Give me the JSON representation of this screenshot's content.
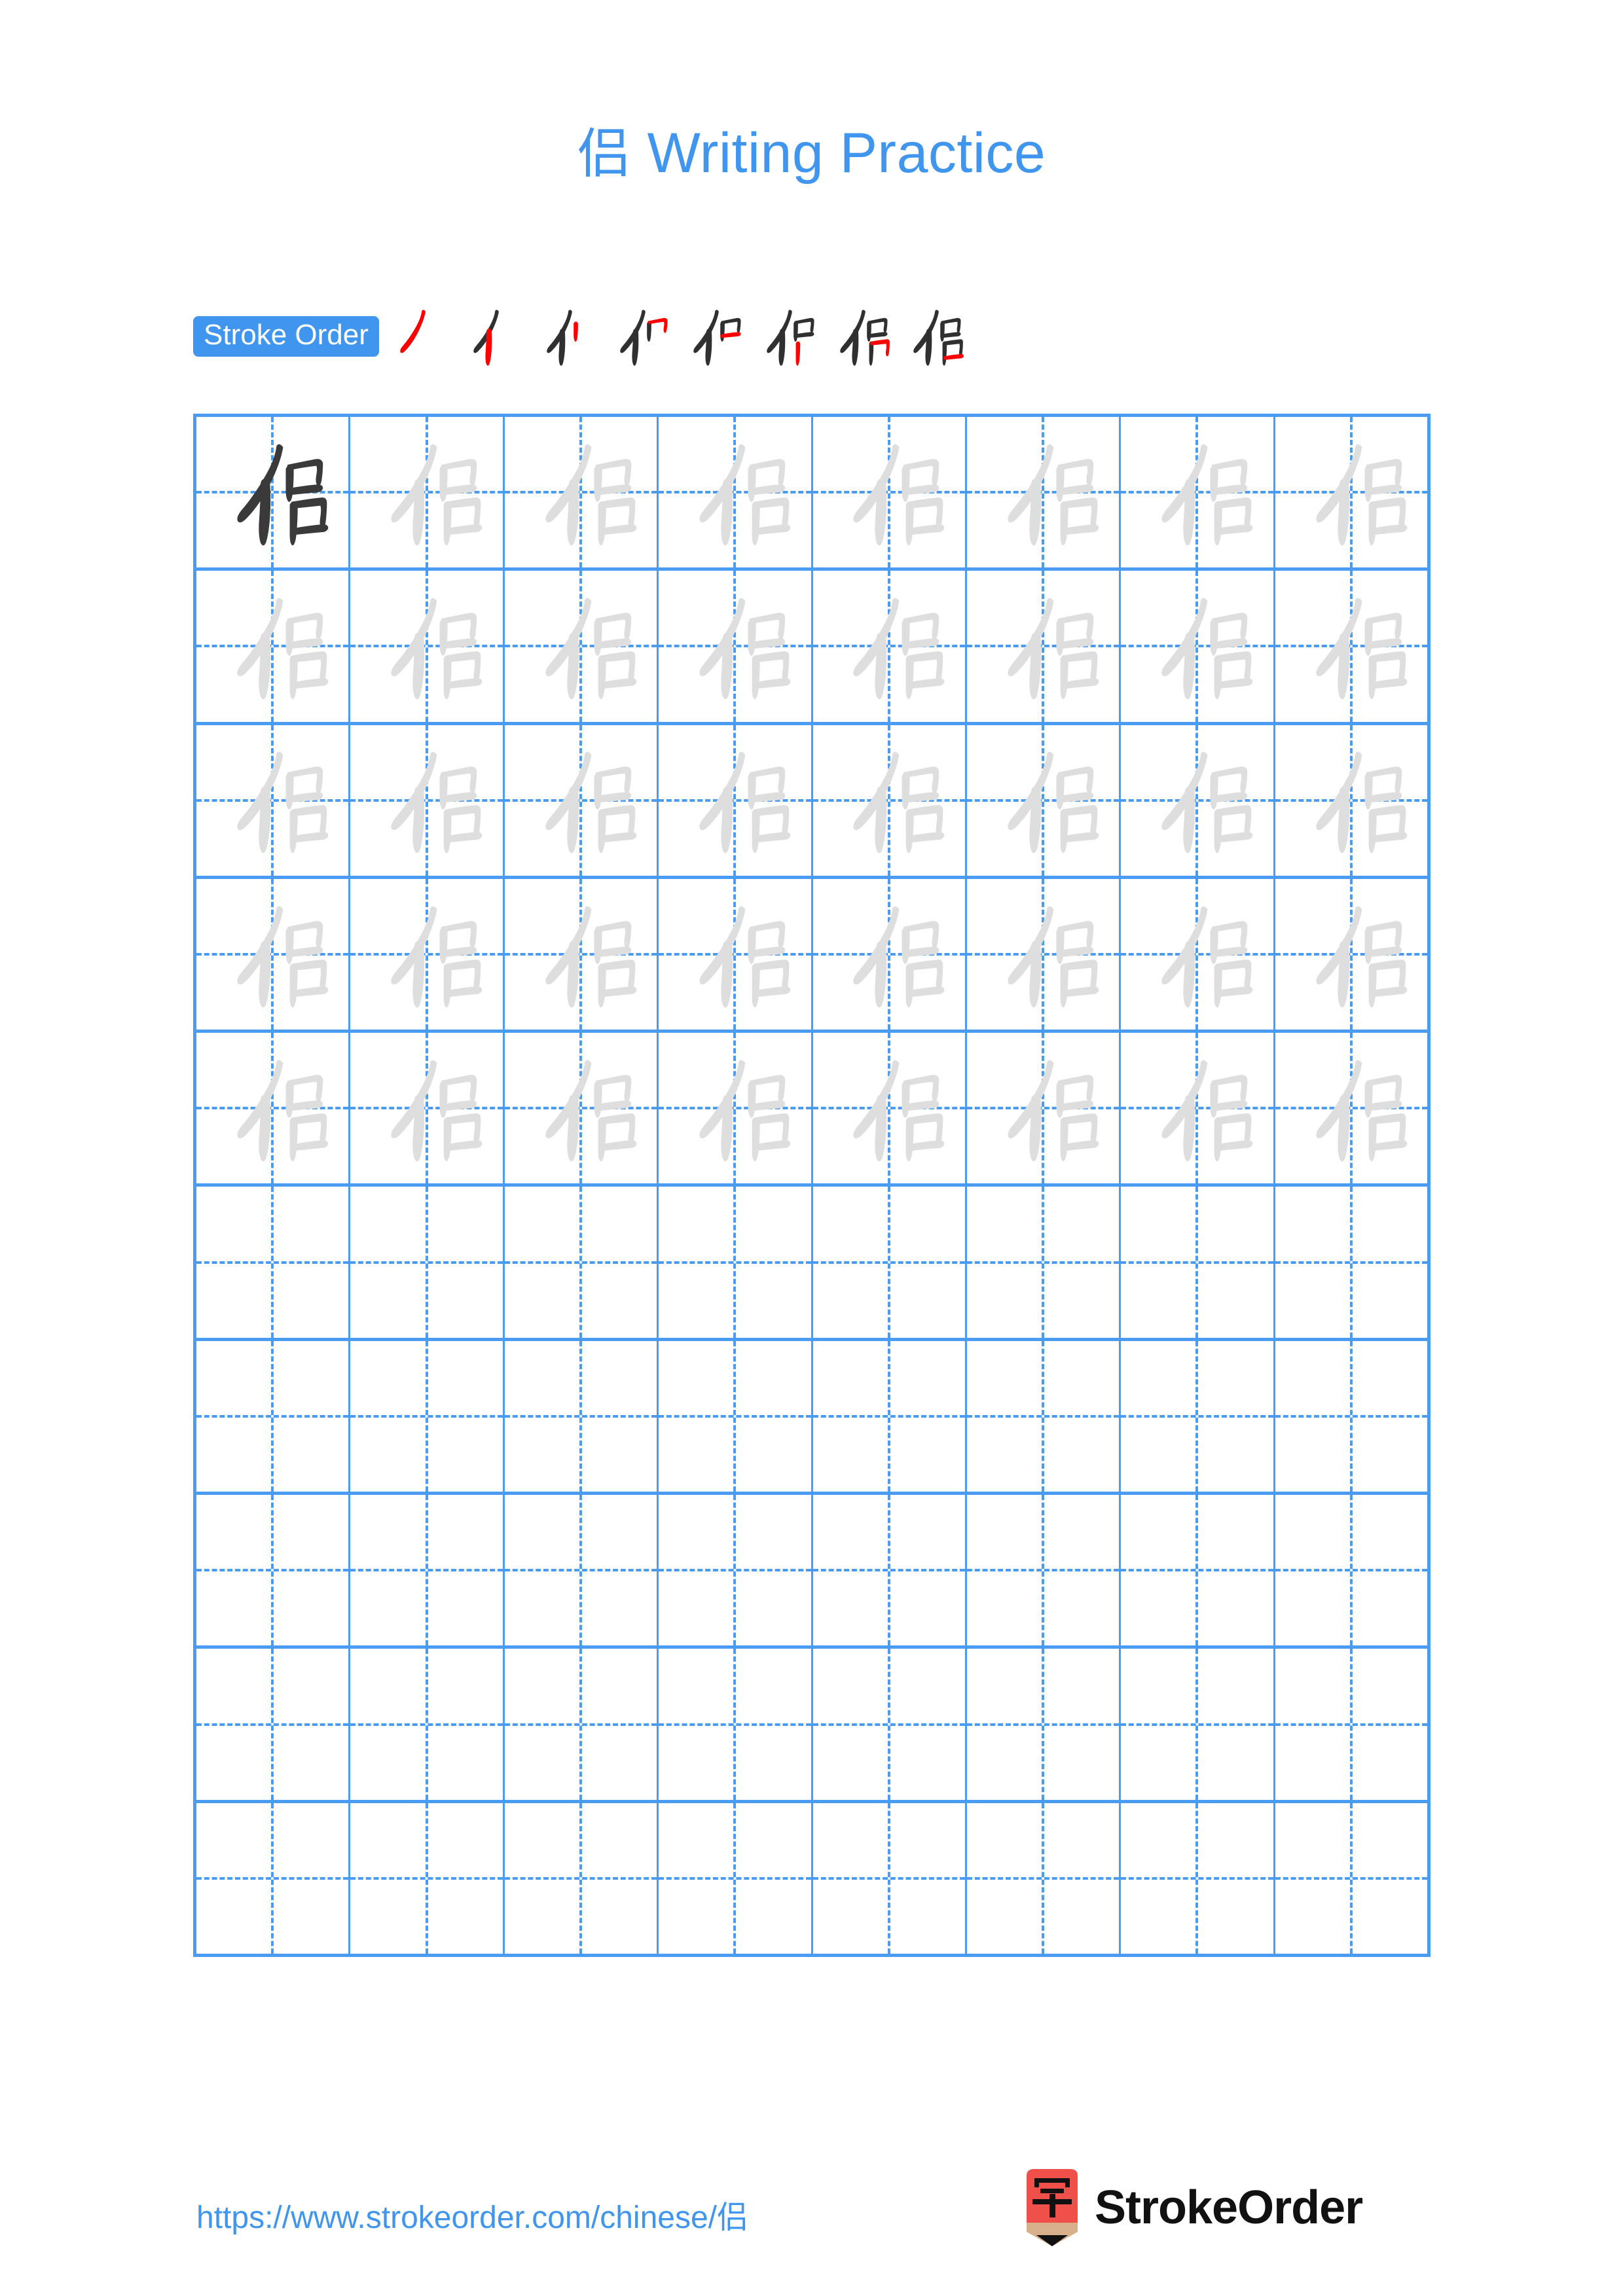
{
  "page": {
    "title_character": "侣",
    "title_text": " Writing Practice",
    "background_color": "#ffffff",
    "accent_color": "#4096ee",
    "grid_line_color": "#4a9cf2",
    "dark_char_color": "#3a3a3a",
    "trace_char_color": "#dedede",
    "stroke_highlight_color": "#ff0000"
  },
  "stroke_order": {
    "badge_label": "Stroke Order",
    "total_strokes": 8,
    "steps": [
      {
        "index": 1,
        "name": "stroke-step-1",
        "new_stroke": "㇒ piě"
      },
      {
        "index": 2,
        "name": "stroke-step-2",
        "new_stroke": "丨 shù"
      },
      {
        "index": 3,
        "name": "stroke-step-3",
        "new_stroke": "丨 shù"
      },
      {
        "index": 4,
        "name": "stroke-step-4",
        "new_stroke": "㇕ héngzhé"
      },
      {
        "index": 5,
        "name": "stroke-step-5",
        "new_stroke": "一 héng"
      },
      {
        "index": 6,
        "name": "stroke-step-6",
        "new_stroke": "丨 shù"
      },
      {
        "index": 7,
        "name": "stroke-step-7",
        "new_stroke": "㇕ héngzhé"
      },
      {
        "index": 8,
        "name": "stroke-step-8",
        "new_stroke": "一 héng"
      }
    ]
  },
  "practice_grid": {
    "columns": 8,
    "rows": 10,
    "model_character": "侣",
    "rows_data": [
      {
        "row": 1,
        "cells": [
          "dark",
          "trace",
          "trace",
          "trace",
          "trace",
          "trace",
          "trace",
          "trace"
        ]
      },
      {
        "row": 2,
        "cells": [
          "trace",
          "trace",
          "trace",
          "trace",
          "trace",
          "trace",
          "trace",
          "trace"
        ]
      },
      {
        "row": 3,
        "cells": [
          "trace",
          "trace",
          "trace",
          "trace",
          "trace",
          "trace",
          "trace",
          "trace"
        ]
      },
      {
        "row": 4,
        "cells": [
          "trace",
          "trace",
          "trace",
          "trace",
          "trace",
          "trace",
          "trace",
          "trace"
        ]
      },
      {
        "row": 5,
        "cells": [
          "trace",
          "trace",
          "trace",
          "trace",
          "trace",
          "trace",
          "trace",
          "trace"
        ]
      },
      {
        "row": 6,
        "cells": [
          "empty",
          "empty",
          "empty",
          "empty",
          "empty",
          "empty",
          "empty",
          "empty"
        ]
      },
      {
        "row": 7,
        "cells": [
          "empty",
          "empty",
          "empty",
          "empty",
          "empty",
          "empty",
          "empty",
          "empty"
        ]
      },
      {
        "row": 8,
        "cells": [
          "empty",
          "empty",
          "empty",
          "empty",
          "empty",
          "empty",
          "empty",
          "empty"
        ]
      },
      {
        "row": 9,
        "cells": [
          "empty",
          "empty",
          "empty",
          "empty",
          "empty",
          "empty",
          "empty",
          "empty"
        ]
      },
      {
        "row": 10,
        "cells": [
          "empty",
          "empty",
          "empty",
          "empty",
          "empty",
          "empty",
          "empty",
          "empty"
        ]
      }
    ]
  },
  "footer": {
    "url_prefix": "https://www.strokeorder.com/chinese/",
    "url_character": "侣",
    "brand_name": "StrokeOrder",
    "brand_mark_character": "字",
    "brand_mark_color": "#f0504a"
  }
}
